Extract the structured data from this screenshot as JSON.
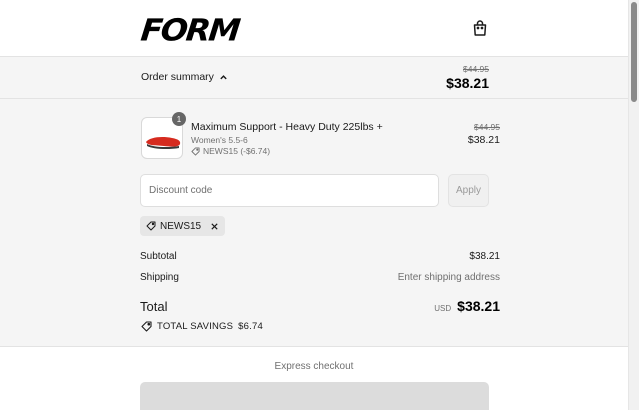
{
  "header": {
    "logo_text": "FORM",
    "bag_icon": "shopping-bag-icon"
  },
  "summary": {
    "toggle_label": "Order summary",
    "original_total": "$44.95",
    "total": "$38.21"
  },
  "line_item": {
    "quantity": "1",
    "name": "Maximum Support - Heavy Duty 225lbs +",
    "variant": "Women's 5.5-6",
    "discount_label": "NEWS15 (-$6.74)",
    "original_price": "$44.95",
    "price": "$38.21"
  },
  "discount": {
    "placeholder": "Discount code",
    "apply_label": "Apply",
    "applied_code": "NEWS15"
  },
  "totals": {
    "subtotal_label": "Subtotal",
    "subtotal_value": "$38.21",
    "shipping_label": "Shipping",
    "shipping_value": "Enter shipping address",
    "total_label": "Total",
    "currency": "USD",
    "total_value": "$38.21",
    "savings_label": "TOTAL SAVINGS",
    "savings_value": "$6.74"
  },
  "express": {
    "label": "Express checkout"
  },
  "colors": {
    "panel_bg": "#f5f5f5",
    "accent_red": "#d62b1f"
  }
}
